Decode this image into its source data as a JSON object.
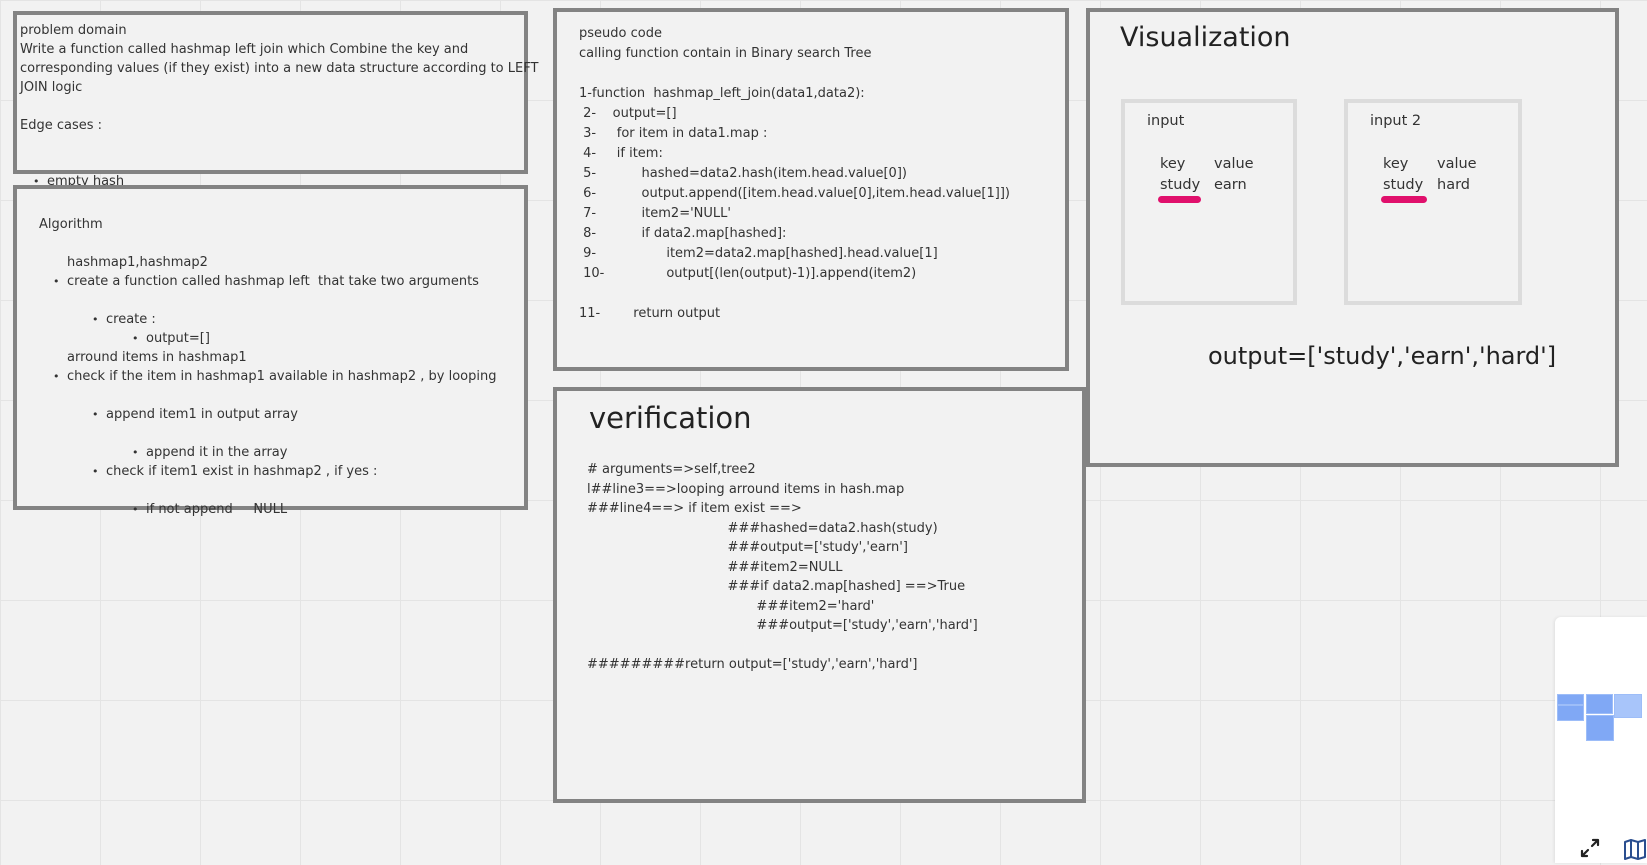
{
  "problem_domain": {
    "heading": "problem domain",
    "description": [
      "Write a function called hashmap left join which Combine the key and",
      "corresponding values (if they exist) into a new data structure according to LEFT",
      "JOIN logic"
    ],
    "edge_heading": "Edge cases :",
    "edge_items": [
      "empty hash"
    ]
  },
  "algorithm": {
    "heading": "Algorithm",
    "step1_a": "create a function called hashmap left  that take two arguments",
    "step1_b": "hashmap1,hashmap2",
    "create": "create :",
    "output_init": "output=[]",
    "step2_a": "check if the item in hashmap1 available in hashmap2 , by looping",
    "step2_b": "arround items in hashmap1",
    "append": "append item1 in output array",
    "check": "check if item1 exist in hashmap2 , if yes :",
    "append_it": "append it in the array",
    "if_not": "if not append     NULL"
  },
  "pseudo": {
    "heading": "pseudo code",
    "subheading": "calling function contain in Binary search Tree",
    "lines": [
      "1-function  hashmap_left_join(data1,data2):",
      " 2-    output=[]",
      " 3-     for item in data1.map :",
      " 4-     if item:",
      " 5-           hashed=data2.hash(item.head.value[0])",
      " 6-           output.append([item.head.value[0],item.head.value[1]])",
      " 7-           item2='NULL'",
      " 8-           if data2.map[hashed]:",
      " 9-                 item2=data2.map[hashed].head.value[1]",
      " 10-               output[(len(output)-1)].append(item2)",
      "",
      "11-        return output"
    ]
  },
  "visualization": {
    "title": "Visualization",
    "input1": {
      "label": "input",
      "key_header": "key",
      "value_header": "value",
      "key": "study",
      "value": "earn"
    },
    "input2": {
      "label": "input 2",
      "key_header": "key",
      "value_header": "value",
      "key": "study",
      "value": "hard"
    },
    "output": "output=['study','earn','hard']"
  },
  "verification": {
    "title": "verification",
    "lines": [
      "# arguments=>self,tree2",
      "l##line3==>looping arround items in hash.map",
      "###line4==> if item exist ==>",
      "                                  ###hashed=data2.hash(study)",
      "                                  ###output=['study','earn']",
      "                                  ###item2=NULL",
      "                                  ###if data2.map[hashed] ==>True",
      "                                         ###item2='hard'",
      "                                         ###output=['study','earn','hard']",
      "",
      "#########return output=['study','earn','hard']"
    ]
  },
  "colors": {
    "frame_border": "#838383",
    "highlight": "#e0106c",
    "minimap": "#80a8f5"
  },
  "icons": [
    "fullscreen-icon",
    "map-icon"
  ]
}
